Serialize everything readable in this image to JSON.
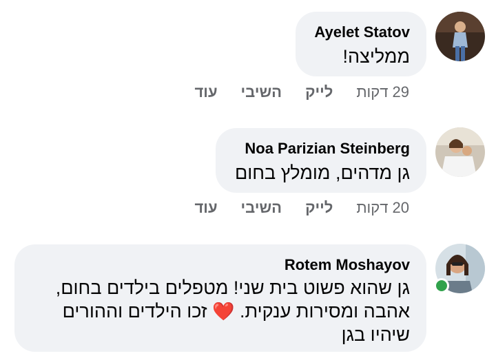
{
  "comments": [
    {
      "author": "Ayelet Statov",
      "text": "ממליצה!",
      "time": "29 דקות",
      "like": "לייק",
      "reply": "השיבי",
      "more": "עוד"
    },
    {
      "author": "Noa Parizian Steinberg",
      "text": "גן מדהים, מומלץ בחום",
      "time": "20 דקות",
      "like": "לייק",
      "reply": "השיבי",
      "more": "עוד"
    },
    {
      "author": "Rotem Moshayov",
      "text_line1": "גן שהוא פשוט בית שני! מטפלים בילדים בחום,",
      "text_line2_a": "אהבה ומסירות ענקית.",
      "text_line2_b": "זכו הילדים וההורים",
      "text_line3": "שיהיו בגן",
      "emoji": "❤️"
    }
  ],
  "colors": {
    "bubble": "#f0f2f5",
    "meta": "#65676b",
    "online": "#31a24c",
    "heart": "#e41e3f"
  },
  "icons": [
    "avatar-ayelet",
    "avatar-noa",
    "avatar-rotem",
    "heart-emoji",
    "online-status-dot"
  ]
}
